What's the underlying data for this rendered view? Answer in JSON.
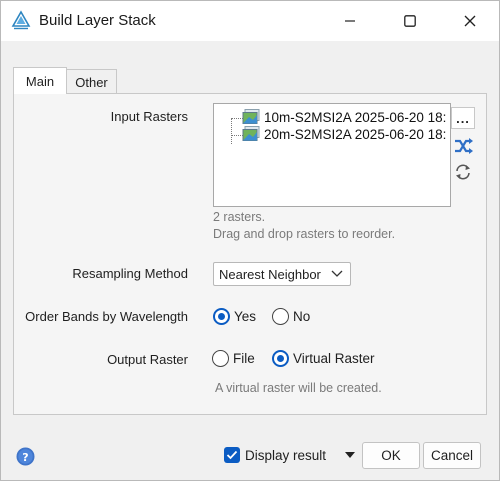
{
  "window": {
    "title": "Build Layer Stack",
    "icon": "build-layer-stack-icon"
  },
  "tabs": [
    {
      "label": "Main",
      "active": true
    },
    {
      "label": "Other",
      "active": false
    }
  ],
  "input_rasters": {
    "label": "Input Rasters",
    "items": [
      {
        "name": "10m-S2MSI2A 2025-06-20 18:"
      },
      {
        "name": "20m-S2MSI2A 2025-06-20 18:"
      }
    ],
    "browse_label": "...",
    "count_text": "2 rasters.",
    "hint_text": "Drag and drop rasters to reorder."
  },
  "resampling": {
    "label": "Resampling Method",
    "selected": "Nearest Neighbor"
  },
  "order_bands": {
    "label": "Order Bands by Wavelength",
    "options": [
      "Yes",
      "No"
    ],
    "selected": "Yes"
  },
  "output_raster": {
    "label": "Output Raster",
    "options": [
      "File",
      "Virtual Raster"
    ],
    "selected": "Virtual Raster",
    "note": "A virtual raster will be created."
  },
  "footer": {
    "display_result_label": "Display result",
    "display_result_checked": true,
    "ok_label": "OK",
    "cancel_label": "Cancel"
  },
  "colors": {
    "accent": "#0b5cc3",
    "hint": "#7a7a7a"
  }
}
